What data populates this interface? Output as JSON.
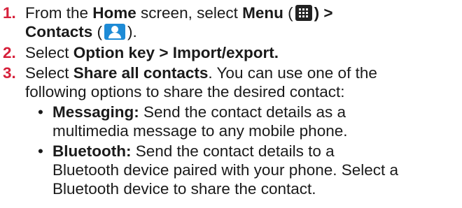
{
  "steps": [
    {
      "number": "1.",
      "line1": {
        "t1": "From the ",
        "b1": "Home",
        "t2": " screen, select ",
        "b2": "Menu",
        "t3": " (",
        "b3": ") >"
      },
      "line2": {
        "b1": "Contacts",
        "t1": " (",
        "t2": ")."
      },
      "icons": [
        "grid-menu-icon",
        "contacts-icon"
      ]
    },
    {
      "number": "2.",
      "t1": "Select ",
      "b1": "Option key > Import/export."
    },
    {
      "number": "3.",
      "t1": "Select ",
      "b1": "Share all contacts",
      "t2": ". You can use one of the",
      "line2": "following options to share the desired contact:"
    }
  ],
  "options": [
    {
      "bullet": "•",
      "label": "Messaging:",
      "line1": " Send the contact details as a",
      "line2": "multimedia message to any mobile phone."
    },
    {
      "bullet": "•",
      "label": "Bluetooth:",
      "line1": " Send the contact details to a",
      "line2": "Bluetooth device paired with your phone. Select a",
      "line3": "Bluetooth device to share the contact."
    }
  ],
  "colors": {
    "step_number": "#d6203a",
    "text": "#1a1a1a",
    "contacts_icon": "#1e8bd6",
    "menu_icon": "#222222"
  }
}
